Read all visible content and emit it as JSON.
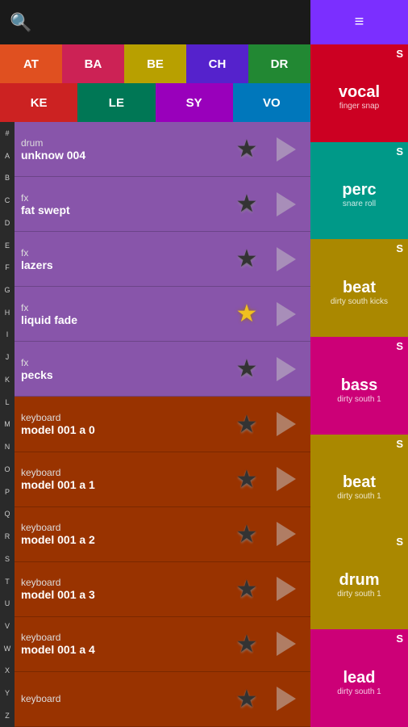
{
  "search": {
    "icon": "🔍"
  },
  "tabs_row1": [
    {
      "label": "AT",
      "color": "#e05020"
    },
    {
      "label": "BA",
      "color": "#cc2255"
    },
    {
      "label": "BE",
      "color": "#b8a000"
    },
    {
      "label": "CH",
      "color": "#5522cc"
    },
    {
      "label": "DR",
      "color": "#228833"
    }
  ],
  "tabs_row2": [
    {
      "label": "KE",
      "color": "#cc2222"
    },
    {
      "label": "LE",
      "color": "#007755"
    },
    {
      "label": "SY",
      "color": "#9900bb"
    },
    {
      "label": "VO",
      "color": "#0077bb"
    }
  ],
  "alphabet": [
    "#",
    "A",
    "B",
    "C",
    "D",
    "E",
    "F",
    "G",
    "H",
    "I",
    "J",
    "K",
    "L",
    "M",
    "N",
    "O",
    "P",
    "Q",
    "R",
    "S",
    "T",
    "U",
    "V",
    "W",
    "X",
    "Y",
    "Z"
  ],
  "list_items": [
    {
      "line1": "drum",
      "line2": "unknow 004",
      "star": "dark",
      "bg": "#8855aa"
    },
    {
      "line1": "fx",
      "line2": "fat swept",
      "star": "dark",
      "bg": "#8855aa"
    },
    {
      "line1": "fx",
      "line2": "lazers",
      "star": "dark",
      "bg": "#8855aa"
    },
    {
      "line1": "fx",
      "line2": "liquid fade",
      "star": "gold",
      "bg": "#8855aa"
    },
    {
      "line1": "fx",
      "line2": "pecks",
      "star": "dark",
      "bg": "#8855aa"
    },
    {
      "line1": "keyboard",
      "line2": "model 001 a 0",
      "star": "dark",
      "bg": "#993300"
    },
    {
      "line1": "keyboard",
      "line2": "model 001 a 1",
      "star": "dark",
      "bg": "#993300"
    },
    {
      "line1": "keyboard",
      "line2": "model 001 a 2",
      "star": "dark",
      "bg": "#993300"
    },
    {
      "line1": "keyboard",
      "line2": "model 001 a 3",
      "star": "dark",
      "bg": "#993300"
    },
    {
      "line1": "keyboard",
      "line2": "model 001 a 4",
      "star": "dark",
      "bg": "#993300"
    },
    {
      "line1": "keyboard",
      "line2": "",
      "star": "dark",
      "bg": "#993300"
    }
  ],
  "right_tiles": [
    {
      "s": "S",
      "label": "vocal",
      "sub": "finger snap",
      "color": "#cc0022"
    },
    {
      "s": "S",
      "label": "perc",
      "sub": "snare roll",
      "color": "#009988"
    },
    {
      "s": "S",
      "label": "beat",
      "sub": "dirty south kicks",
      "color": "#aa8800"
    },
    {
      "s": "S",
      "label": "bass",
      "sub": "dirty south 1",
      "color": "#cc0077"
    },
    {
      "s": "S",
      "label": "beat",
      "sub": "dirty south 1",
      "color": "#aa8800"
    },
    {
      "s": "S",
      "label": "drum",
      "sub": "dirty south 1",
      "color": "#aa8800"
    },
    {
      "s": "S",
      "label": "lead",
      "sub": "dirty south 1",
      "color": "#cc0077"
    }
  ],
  "menu_icon": "≡"
}
